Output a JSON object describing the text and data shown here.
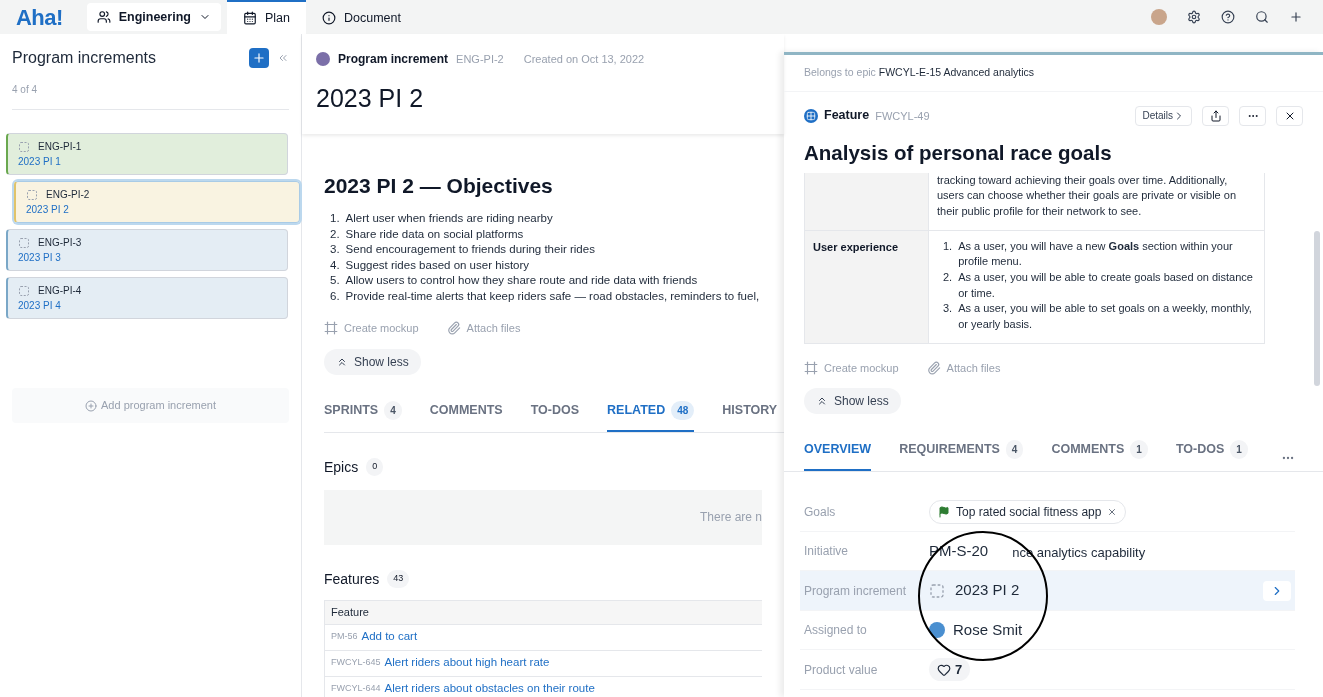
{
  "topbar": {
    "logo": "Aha!",
    "workspace": "Engineering",
    "tabs": [
      {
        "label": "Plan",
        "selected": true,
        "kind": "calendar"
      },
      {
        "label": "Document",
        "selected": false,
        "kind": "info"
      }
    ]
  },
  "sidebar": {
    "title": "Program increments",
    "count": "4 of 4",
    "items": [
      {
        "id": "ENG-PI-1",
        "name": "2023 PI 1",
        "selected": false,
        "color": "#6aa84f"
      },
      {
        "id": "ENG-PI-2",
        "name": "2023 PI 2",
        "selected": true,
        "color": "#e0c36a"
      },
      {
        "id": "ENG-PI-3",
        "name": "2023 PI 3",
        "selected": false,
        "color": "#7aa7c7"
      },
      {
        "id": "ENG-PI-4",
        "name": "2023 PI 4",
        "selected": false,
        "color": "#7aa7c7"
      }
    ],
    "add": "Add program increment"
  },
  "record": {
    "type": "Program increment",
    "id": "ENG-PI-2",
    "created": "Created on Oct 13, 2022",
    "title": "2023 PI 2",
    "heading": "2023 PI 2 — Objectives",
    "objectives": [
      {
        "number": "1.",
        "text": "Alert user when friends are riding nearby"
      },
      {
        "number": "2.",
        "text": "Share ride data on social platforms"
      },
      {
        "number": "3.",
        "text": "Send encouragement to friends during their rides"
      },
      {
        "number": "4.",
        "text": "Suggest rides based on user history"
      },
      {
        "number": "5.",
        "text": "Allow users to control how they share route and ride data with friends"
      },
      {
        "number": "6.",
        "text": "Provide real-time alerts that keep riders safe — road obstacles, reminders to fuel,"
      }
    ],
    "actions": [
      {
        "label": "Create mockup",
        "kind": "mockup"
      },
      {
        "label": "Attach files",
        "kind": "attach"
      }
    ],
    "show_less": "Show less",
    "tabs": [
      {
        "label": "SPRINTS",
        "count": "4",
        "selected": false
      },
      {
        "label": "COMMENTS",
        "selected": false
      },
      {
        "label": "TO-DOS",
        "selected": false
      },
      {
        "label": "RELATED",
        "count": "48",
        "selected": true
      },
      {
        "label": "HISTORY",
        "selected": false
      }
    ],
    "epics": {
      "title": "Epics",
      "count": "0",
      "empty": "There are n"
    },
    "features": {
      "title": "Features",
      "count": "43",
      "column": "Feature",
      "rows": [
        {
          "id": "PM-56",
          "name": "Add to cart"
        },
        {
          "id": "FWCYL-645",
          "name": "Alert riders about high heart rate"
        },
        {
          "id": "FWCYL-644",
          "name": "Alert riders about obstacles on their route"
        }
      ]
    }
  },
  "drawer": {
    "epic_label": "Belongs to epic",
    "epic": "FWCYL-E-15 Advanced analytics",
    "type": "Feature",
    "id": "FWCYL-49",
    "details": "Details",
    "title": "Analysis of personal race goals",
    "description_tail": "tracking toward achieving their goals over time. Additionally, users can choose whether their goals are private or visible on their public profile for their network to see.",
    "table_rows": [
      {
        "label": "User experience",
        "items": [
          {
            "number": "1.",
            "text": "As a user, you will have a new **Goals** section within your profile menu."
          },
          {
            "number": "2.",
            "text": "As a user, you will be able to create goals based on distance or time."
          },
          {
            "number": "3.",
            "text": "As a user, you will be able to set goals on a weekly, monthly, or yearly basis."
          }
        ]
      }
    ],
    "actions": [
      {
        "label": "Create mockup",
        "kind": "mockup"
      },
      {
        "label": "Attach files",
        "kind": "attach"
      }
    ],
    "show_less": "Show less",
    "tabs": [
      {
        "label": "OVERVIEW",
        "selected": true
      },
      {
        "label": "REQUIREMENTS",
        "count": "4",
        "selected": false
      },
      {
        "label": "COMMENTS",
        "count": "1",
        "selected": false
      },
      {
        "label": "TO-DOS",
        "count": "1",
        "selected": false
      }
    ],
    "fields": [
      {
        "label": "Goals",
        "kind": "tag",
        "value": "Top rated social fitness app",
        "selected": false
      },
      {
        "label": "Initiative",
        "kind": "initiative",
        "id": "PM-S-20",
        "value": "nce analytics capability",
        "selected": false
      },
      {
        "label": "Program increment",
        "kind": "link",
        "value": "2023 PI 2",
        "selected": true
      },
      {
        "label": "Assigned to",
        "kind": "user",
        "value": "Rose Smit",
        "selected": false
      },
      {
        "label": "Product value",
        "kind": "score",
        "value": "7",
        "selected": false
      }
    ]
  }
}
